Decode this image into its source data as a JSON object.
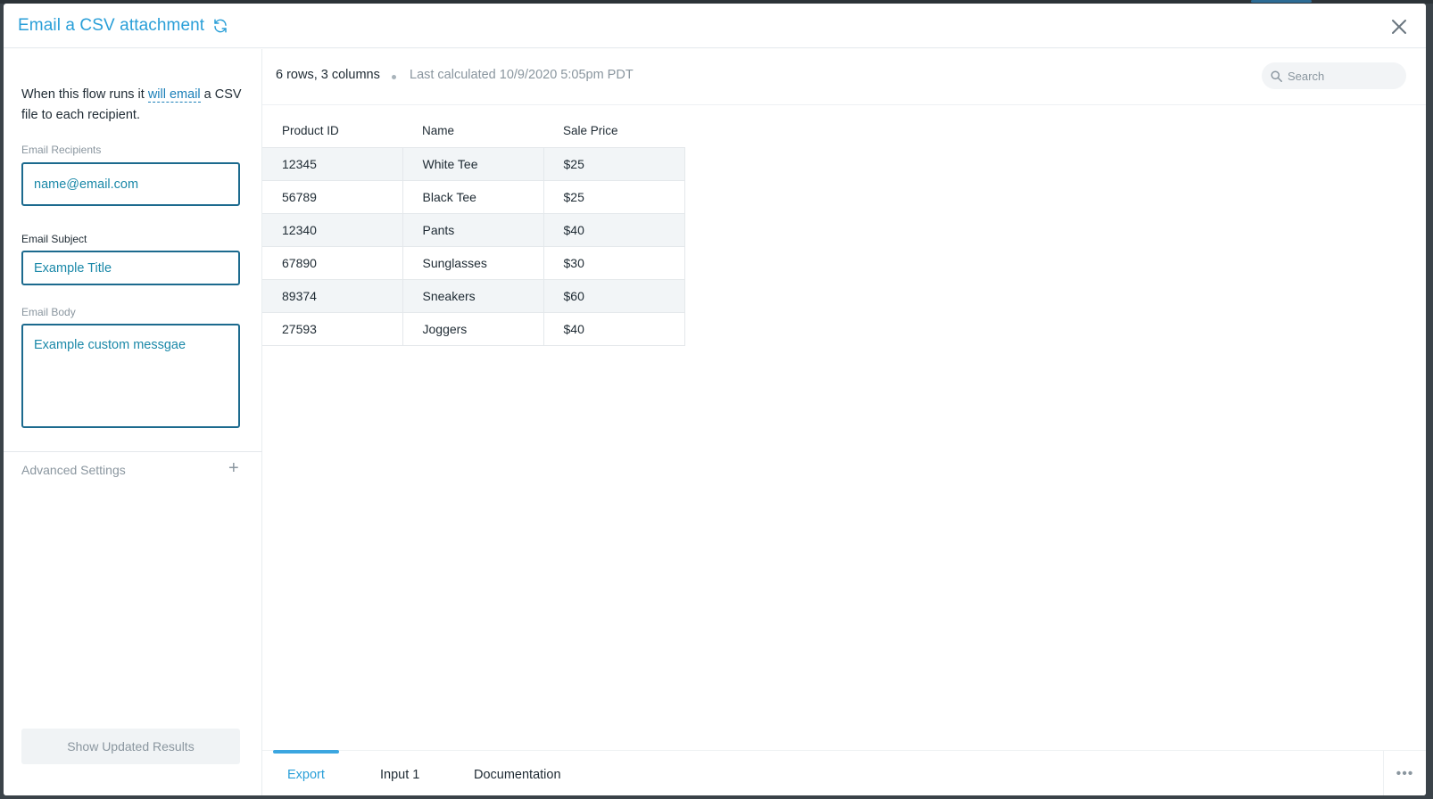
{
  "header": {
    "title": "Email a CSV attachment",
    "refresh_icon": "refresh-icon",
    "close_icon": "close-icon"
  },
  "sidebar": {
    "intro_prefix": "When this flow runs it ",
    "intro_link": "will email",
    "intro_suffix": " a CSV file to each recipient.",
    "recipients": {
      "label": "Email Recipients",
      "value": "name@email.com"
    },
    "subject": {
      "label": "Email Subject",
      "value": "Example Title"
    },
    "body": {
      "label": "Email Body",
      "value": "Example custom messgae"
    },
    "advanced_label": "Advanced Settings",
    "advanced_icon": "plus-icon",
    "show_button": "Show Updated Results"
  },
  "results": {
    "stats": "6 rows, 3 columns",
    "last_calculated": "Last calculated 10/9/2020 5:05pm PDT",
    "search_placeholder": "Search",
    "columns": [
      "Product ID",
      "Name",
      "Sale Price"
    ],
    "rows": [
      [
        "12345",
        "White Tee",
        "$25"
      ],
      [
        "56789",
        "Black Tee",
        "$25"
      ],
      [
        "12340",
        "Pants",
        "$40"
      ],
      [
        "67890",
        "Sunglasses",
        "$30"
      ],
      [
        "89374",
        "Sneakers",
        "$60"
      ],
      [
        "27593",
        "Joggers",
        "$40"
      ]
    ]
  },
  "tabs": [
    {
      "label": "Export",
      "active": true
    },
    {
      "label": "Input 1",
      "active": false
    },
    {
      "label": "Documentation",
      "active": false
    }
  ],
  "more_icon": "more-horizontal-icon",
  "colors": {
    "accent": "#2a9fd8",
    "field_border": "#1c6a8e",
    "field_text": "#1a88a8"
  }
}
